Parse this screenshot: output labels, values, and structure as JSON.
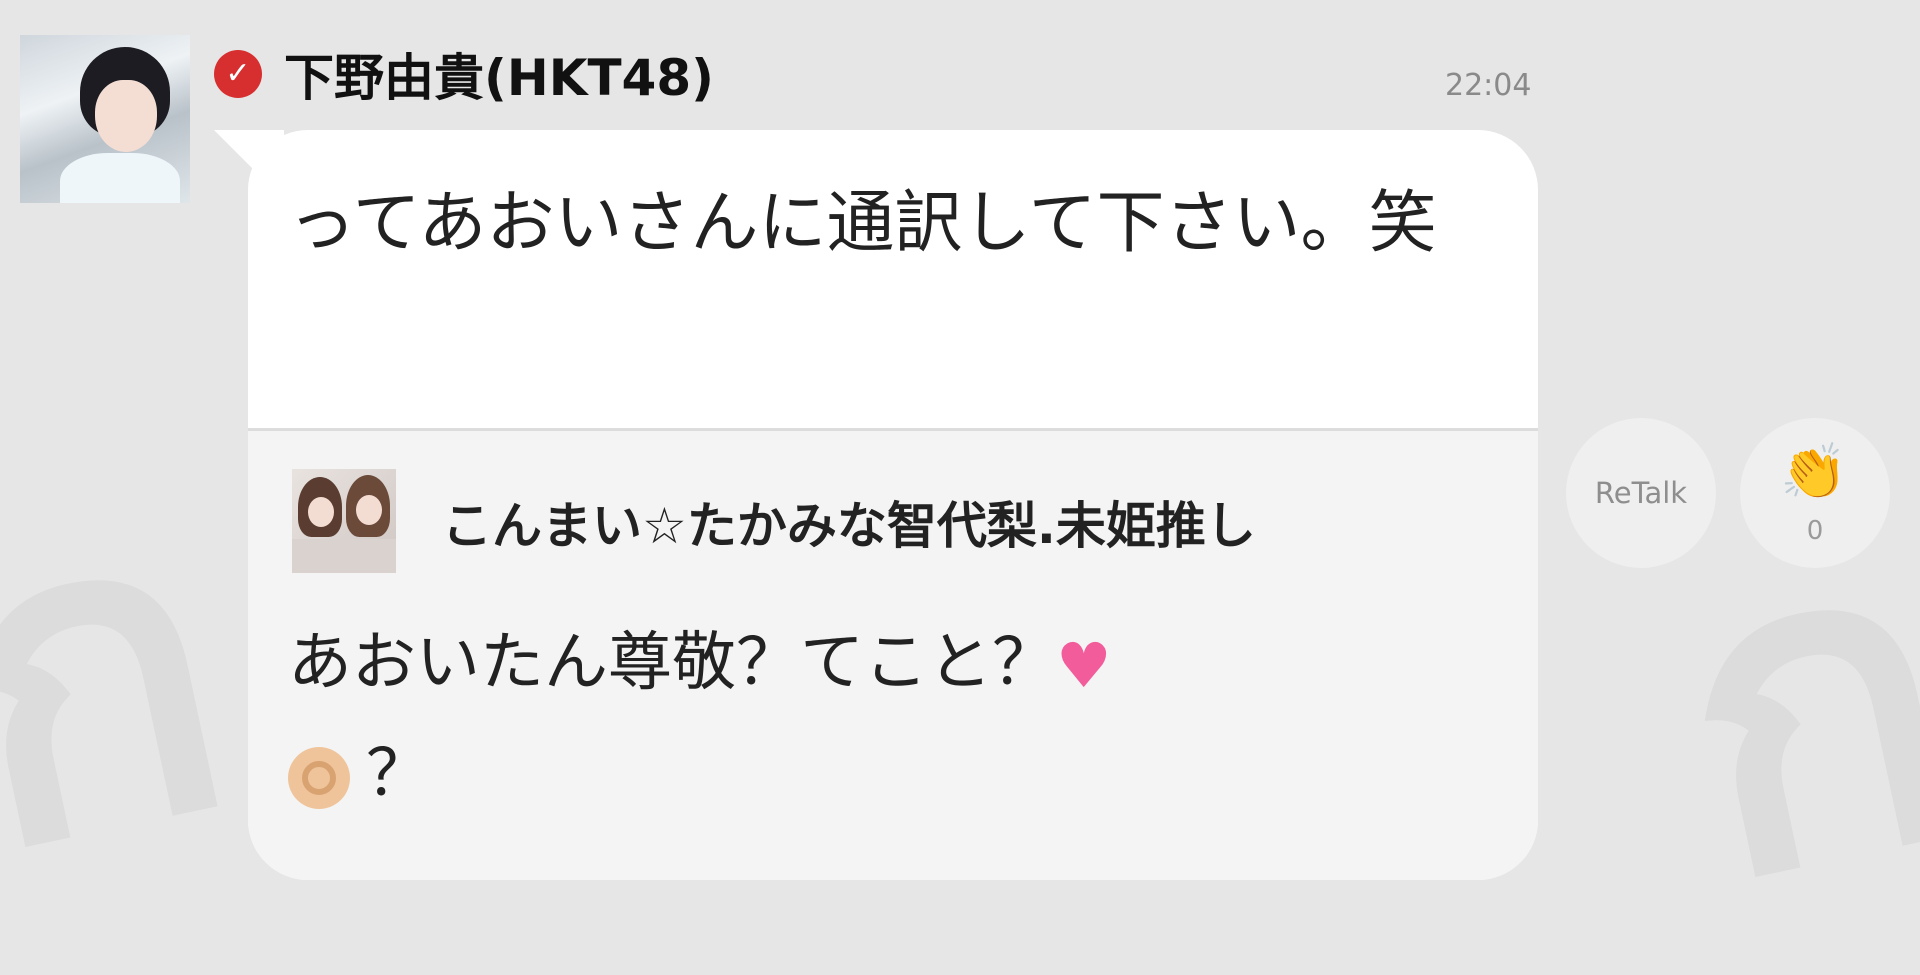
{
  "post": {
    "sender_name": "下野由貴(HKT48)",
    "timestamp": "22:04",
    "message": "ってあおいさんに通訳して下さい。笑",
    "verified_icon": "verified-check-icon",
    "verified_color": "#d72f2f"
  },
  "quote": {
    "name": "こんまい☆たかみな智代梨.未姫推し",
    "text_line1": "あおいたん尊敬？てこと？",
    "text_line2": "？",
    "emojis": [
      "pink-heart-icon",
      "ok-hand-icon"
    ]
  },
  "actions": {
    "retalk_label": "ReTalk",
    "clap_count": "0",
    "clap_icon": "clapping-hands-icon"
  }
}
